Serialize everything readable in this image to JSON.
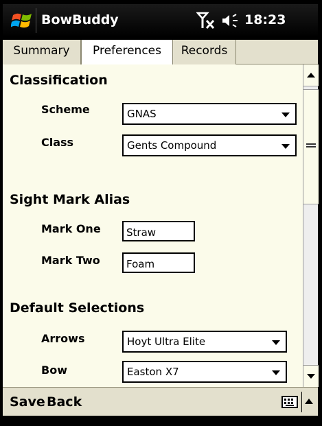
{
  "titlebar": {
    "app_title": "BowBuddy",
    "clock": "18:23",
    "icons": [
      "windows-start-icon",
      "no-signal-icon",
      "volume-icon"
    ]
  },
  "tabs": [
    {
      "label": "Summary",
      "active": false
    },
    {
      "label": "Preferences",
      "active": true
    },
    {
      "label": "Records",
      "active": false
    }
  ],
  "classification": {
    "header": "Classification",
    "scheme_label": "Scheme",
    "scheme_value": "GNAS",
    "class_label": "Class",
    "class_value": "Gents Compound"
  },
  "sight_mark_alias": {
    "header": "Sight Mark Alias",
    "mark_one_label": "Mark One",
    "mark_one_value": "Straw",
    "mark_two_label": "Mark Two",
    "mark_two_value": "Foam"
  },
  "default_selections": {
    "header": "Default Selections",
    "arrows_label": "Arrows",
    "arrows_value": "Hoyt Ultra Elite",
    "bow_label": "Bow",
    "bow_value": "Easton X7"
  },
  "menubar": {
    "save_label": "Save",
    "back_label": "Back"
  },
  "colors": {
    "content_background": "#fbfbea",
    "tab_background": "#e3e0cd",
    "titlebar": "#000000"
  }
}
